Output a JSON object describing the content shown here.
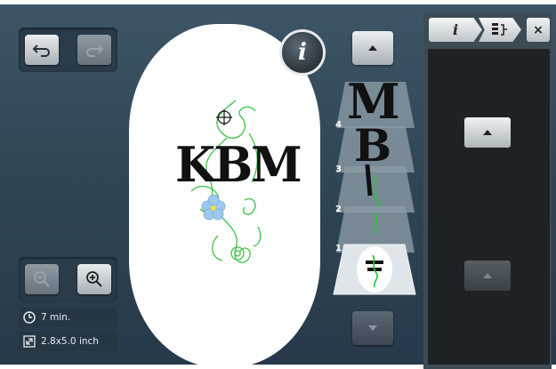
{
  "info": {
    "stitch_time": "7 min.",
    "design_size": "2.8x5.0 inch"
  },
  "hoop": {
    "info_button_label": "i",
    "monogram_text": "KBM"
  },
  "layers": [
    {
      "number": "4",
      "letter": "M"
    },
    {
      "number": "3",
      "letter": "B"
    },
    {
      "number": "2",
      "letter": ""
    },
    {
      "number": "1",
      "letter": ""
    }
  ],
  "right_panel": {
    "tab_info_label": "i",
    "close_label": "×"
  },
  "colors": {
    "accent_green": "#2fbf3a",
    "screen_bg": "#2f4453",
    "flower_blue": "#9fc8ee"
  }
}
